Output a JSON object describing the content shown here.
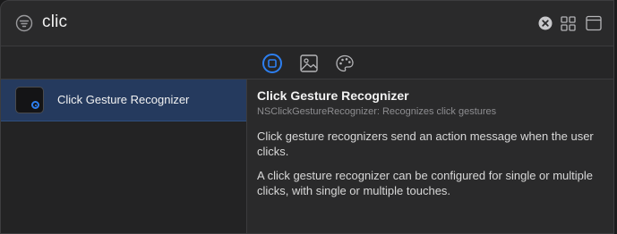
{
  "search": {
    "query": "clic"
  },
  "toolbar": {
    "filter_icon": "filter-icon",
    "clear_icon": "clear-search-icon",
    "grid_icon": "grid-view-icon",
    "pane_icon": "detail-pane-icon"
  },
  "tabs": [
    {
      "name": "objects",
      "icon": "objects-icon",
      "selected": true
    },
    {
      "name": "media",
      "icon": "image-icon",
      "selected": false
    },
    {
      "name": "colors",
      "icon": "palette-icon",
      "selected": false
    }
  ],
  "list": {
    "items": [
      {
        "label": "Click Gesture Recognizer",
        "selected": true
      }
    ]
  },
  "detail": {
    "title": "Click Gesture Recognizer",
    "subtitle": "NSClickGestureRecognizer: Recognizes click gestures",
    "description": "Click gesture recognizers send an action message when the user clicks.",
    "description2": "A click gesture recognizer can be configured for single or multiple clicks, with single or multiple touches."
  },
  "colors": {
    "accent": "#2d7ff0",
    "selection": "#253a5e",
    "background": "#2a2a2b"
  }
}
